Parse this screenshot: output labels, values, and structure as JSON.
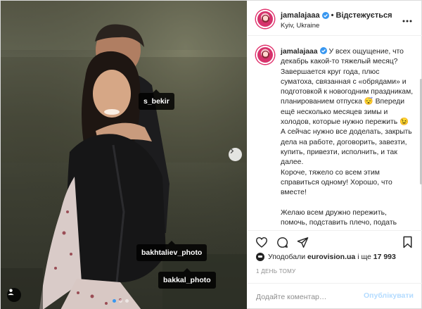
{
  "post": {
    "photo": {
      "tags": [
        "s_bekir",
        "bakhtaliev_photo",
        "bakkal_photo"
      ],
      "carousel_count": 3,
      "carousel_active": 1
    },
    "header": {
      "username": "jamalajaaa",
      "separator": "•",
      "follow_label": "Відстежується",
      "location": "Kyiv, Ukraine",
      "more_icon": "more-dots-icon"
    },
    "caption": {
      "username": "jamalajaaa",
      "text": " У всех ощущение, что декабрь какой-то тяжелый месяц? Завершается круг года, плюс суматоха, связанная с «обрядами» и подготовкой к новогодним праздникам, планированием отпуска 😴 Впереди ещё несколько месяцев зимы и холодов, которые нужно пережить 😉\nА сейчас нужно все доделать, закрыть дела на работе, договорить, завезти, купить, привезти, исполнить, и так далее.\nКороче, тяжело со всем этим справиться одному! Хорошо, что вместе!\n\nЖелаю всем дружно пережить, помочь, подставить плечо, подать"
    },
    "likes": {
      "prefix": "Уподобали",
      "account": "eurovision.ua",
      "middle": "і ще",
      "count": "17 993"
    },
    "date": "1 ДЕНЬ ТОМУ",
    "comment": {
      "placeholder": "Додайте коментар…",
      "post_label": "Опублікувати"
    },
    "colors": {
      "accent": "#3897f0",
      "verified": "#3897f0",
      "post_disabled": "#b3dbff",
      "text": "#262626",
      "muted": "#8e8e8e"
    }
  }
}
